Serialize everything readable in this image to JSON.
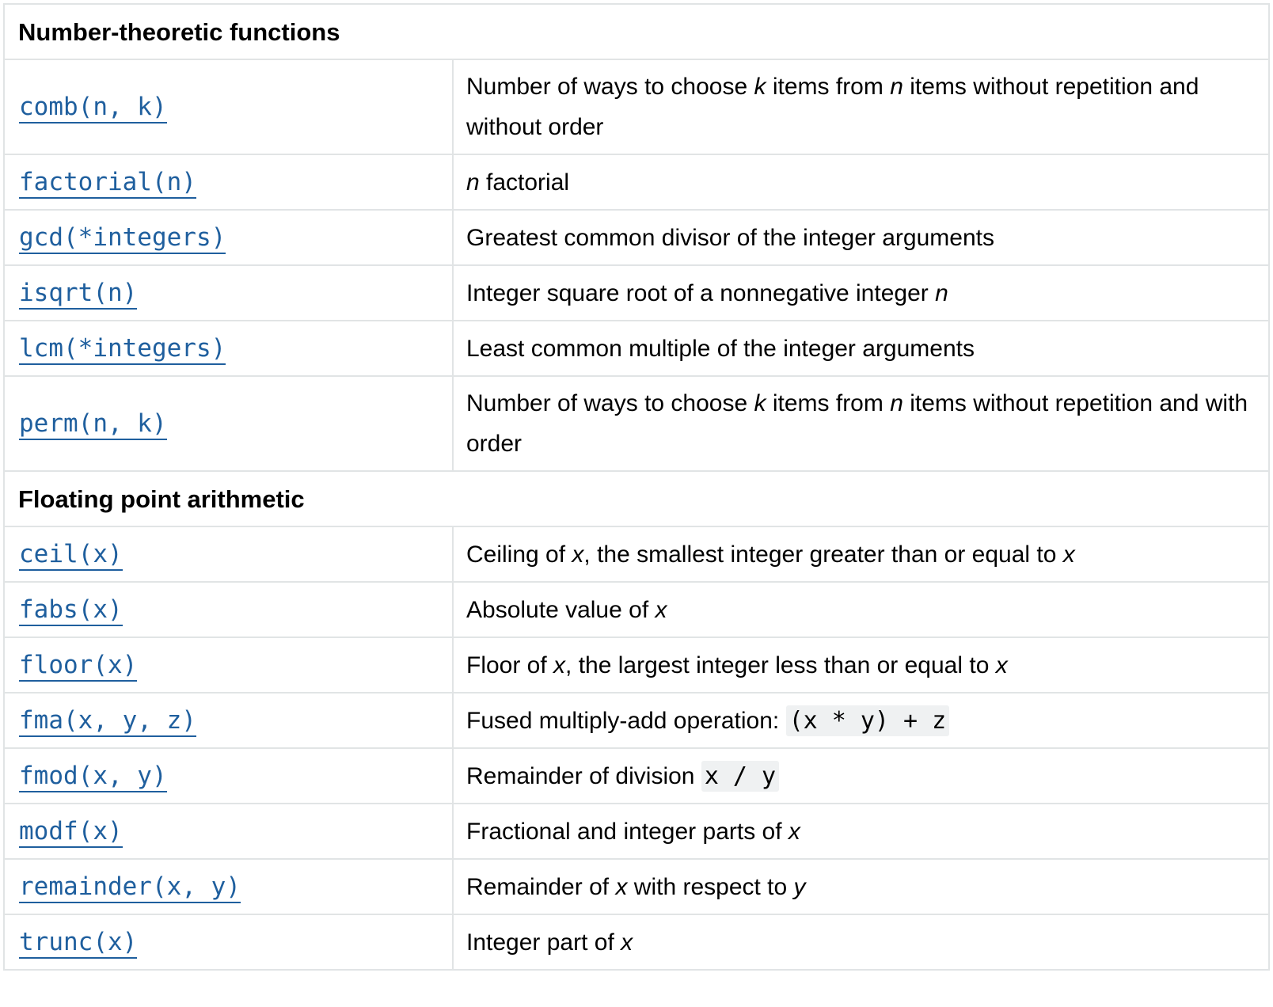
{
  "sections": [
    {
      "title": "Number-theoretic functions",
      "rows": [
        {
          "fn": "comb(n, k)",
          "desc": [
            {
              "t": "Number of ways to choose "
            },
            {
              "t": "k",
              "i": true
            },
            {
              "t": " items from "
            },
            {
              "t": "n",
              "i": true
            },
            {
              "t": " items without repetition and without order"
            }
          ]
        },
        {
          "fn": "factorial(n)",
          "desc": [
            {
              "t": "n",
              "i": true
            },
            {
              "t": " factorial"
            }
          ]
        },
        {
          "fn": "gcd(*integers)",
          "desc": [
            {
              "t": "Greatest common divisor of the integer arguments"
            }
          ]
        },
        {
          "fn": "isqrt(n)",
          "desc": [
            {
              "t": "Integer square root of a nonnegative integer "
            },
            {
              "t": "n",
              "i": true
            }
          ]
        },
        {
          "fn": "lcm(*integers)",
          "desc": [
            {
              "t": "Least common multiple of the integer arguments"
            }
          ]
        },
        {
          "fn": "perm(n, k)",
          "desc": [
            {
              "t": "Number of ways to choose "
            },
            {
              "t": "k",
              "i": true
            },
            {
              "t": " items from "
            },
            {
              "t": "n",
              "i": true
            },
            {
              "t": " items without repetition and with order"
            }
          ]
        }
      ]
    },
    {
      "title": "Floating point arithmetic",
      "rows": [
        {
          "fn": "ceil(x)",
          "desc": [
            {
              "t": "Ceiling of "
            },
            {
              "t": "x",
              "i": true
            },
            {
              "t": ", the smallest integer greater than or equal to "
            },
            {
              "t": "x",
              "i": true
            }
          ]
        },
        {
          "fn": "fabs(x)",
          "desc": [
            {
              "t": "Absolute value of "
            },
            {
              "t": "x",
              "i": true
            }
          ]
        },
        {
          "fn": "floor(x)",
          "desc": [
            {
              "t": "Floor of "
            },
            {
              "t": "x",
              "i": true
            },
            {
              "t": ", the largest integer less than or equal to "
            },
            {
              "t": "x",
              "i": true
            }
          ]
        },
        {
          "fn": "fma(x, y, z)",
          "desc": [
            {
              "t": "Fused multiply-add operation: "
            },
            {
              "t": "(x * y) + z",
              "c": true
            }
          ]
        },
        {
          "fn": "fmod(x, y)",
          "desc": [
            {
              "t": "Remainder of division "
            },
            {
              "t": "x / y",
              "c": true
            }
          ]
        },
        {
          "fn": "modf(x)",
          "desc": [
            {
              "t": "Fractional and integer parts of "
            },
            {
              "t": "x",
              "i": true
            }
          ]
        },
        {
          "fn": "remainder(x, y)",
          "desc": [
            {
              "t": "Remainder of "
            },
            {
              "t": "x",
              "i": true
            },
            {
              "t": " with respect to "
            },
            {
              "t": "y",
              "i": true
            }
          ]
        },
        {
          "fn": "trunc(x)",
          "desc": [
            {
              "t": "Integer part of "
            },
            {
              "t": "x",
              "i": true
            }
          ]
        }
      ]
    }
  ],
  "colors": {
    "link": "#1f5f9e",
    "border": "#e1e4e5",
    "code_bg": "#eff1f2"
  }
}
